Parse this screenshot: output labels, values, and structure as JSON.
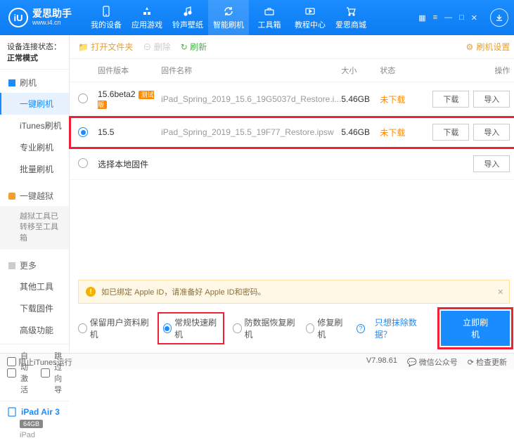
{
  "brand": {
    "cn": "爱思助手",
    "en": "www.i4.cn",
    "logo_letter": "iU"
  },
  "nav": {
    "items": [
      {
        "label": "我的设备"
      },
      {
        "label": "应用游戏"
      },
      {
        "label": "铃声壁纸"
      },
      {
        "label": "智能刷机"
      },
      {
        "label": "工具箱"
      },
      {
        "label": "教程中心"
      },
      {
        "label": "爱思商城"
      }
    ]
  },
  "sidebar": {
    "conn_label": "设备连接状态：",
    "conn_value": "正常模式",
    "group_flash": "刷机",
    "items_flash": [
      "一键刷机",
      "iTunes刷机",
      "专业刷机",
      "批量刷机"
    ],
    "group_jail": "一键越狱",
    "jail_note": "越狱工具已转移至工具箱",
    "group_more": "更多",
    "items_more": [
      "其他工具",
      "下载固件",
      "高级功能"
    ],
    "auto_activate": "自动激活",
    "skip_guide": "跳过向导",
    "device_name": "iPad Air 3",
    "device_storage": "64GB",
    "device_type": "iPad"
  },
  "toolbar": {
    "open_folder": "打开文件夹",
    "delete": "删除",
    "refresh": "刷新",
    "settings": "刷机设置"
  },
  "table": {
    "h_version": "固件版本",
    "h_name": "固件名称",
    "h_size": "大小",
    "h_status": "状态",
    "h_ops": "操作",
    "rows": [
      {
        "version": "15.6beta2",
        "badge": "测试版",
        "name": "iPad_Spring_2019_15.6_19G5037d_Restore.i...",
        "size": "5.46GB",
        "status": "未下载"
      },
      {
        "version": "15.5",
        "badge": "",
        "name": "iPad_Spring_2019_15.5_19F77_Restore.ipsw",
        "size": "5.46GB",
        "status": "未下载"
      }
    ],
    "local_fw": "选择本地固件",
    "btn_download": "下载",
    "btn_import": "导入"
  },
  "warning": "如已绑定 Apple ID，请准备好 Apple ID和密码。",
  "options": {
    "keep_data": "保留用户资料刷机",
    "normal_fast": "常规快速刷机",
    "anti_recovery": "防数据恢复刷机",
    "repair": "修复刷机",
    "exclude_link": "只想抹除数据？",
    "flash_now": "立即刷机"
  },
  "statusbar": {
    "block_itunes": "阻止iTunes运行",
    "version": "V7.98.61",
    "wechat": "微信公众号",
    "check_update": "检查更新"
  }
}
